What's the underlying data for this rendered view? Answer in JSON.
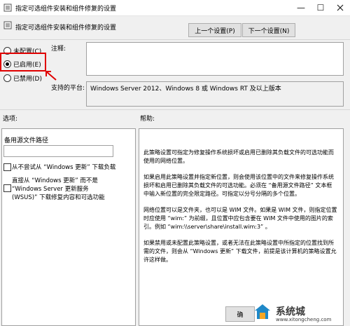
{
  "window": {
    "title": "指定可选组件安装和组件修复的设置",
    "minimize_glyph": "—",
    "maximize_glyph": "☐"
  },
  "header": {
    "title": "指定可选组件安装和组件修复的设置",
    "prev_label": "上一个设置(P)",
    "next_label": "下一个设置(N)"
  },
  "state": {
    "options": [
      {
        "label": "未配置(C)",
        "selected": false
      },
      {
        "label": "已启用(E)",
        "selected": true
      },
      {
        "label": "已禁用(D)",
        "selected": false
      }
    ]
  },
  "comment": {
    "label": "注释:",
    "value": ""
  },
  "platform": {
    "label": "支持的平台:",
    "value": "Windows Server 2012、Windows 8 或 Windows RT 及以上版本"
  },
  "options_section": {
    "label": "选项:",
    "path_label": "备用源文件路径",
    "path_value": "",
    "checkbox1": "从不尝试从 “Windows 更新” 下载负载",
    "checkbox2_line1": "直接从 “Windows 更新” 而不是",
    "checkbox2_line2": "“Windows Server 更新服务",
    "checkbox2_line3": "(WSUS)” 下载修复内容和可选功能"
  },
  "help": {
    "label": "帮助:",
    "paragraphs": [
      "此策略设置可指定为修复操作系统损坏或启用已删除其负载文件的可选功能而使用的网络位置。",
      "如果启用此策略设置并指定新位置，则会使用该位置中的文件来修复操作系统损坏和启用已删除其负载文件的可选功能。必须在 “备用源文件路径” 文本框中输入新位置的完全限定路径。可指定以分号分隔的多个位置。",
      "网络位置可以是文件夹，也可以是 WIM 文件。如果是 WIM 文件，则指定位置时应使用 “wim:” 为前缀，且位置中应包含要在 WIM 文件中使用的图片的索引。例如 “wim:\\\\server\\share\\install.wim:3” 。",
      "如果禁用或未配置此策略设置，或者无法在此策略设置中所指定的位置找到所需的文件，则会从 “Windows 更新” 下载文件，前提是该计算机的策略设置允许这样做。"
    ]
  },
  "footer": {
    "ok_label": "确"
  },
  "watermark": {
    "title": "系统城",
    "url": "www.xitongcheng.com"
  }
}
